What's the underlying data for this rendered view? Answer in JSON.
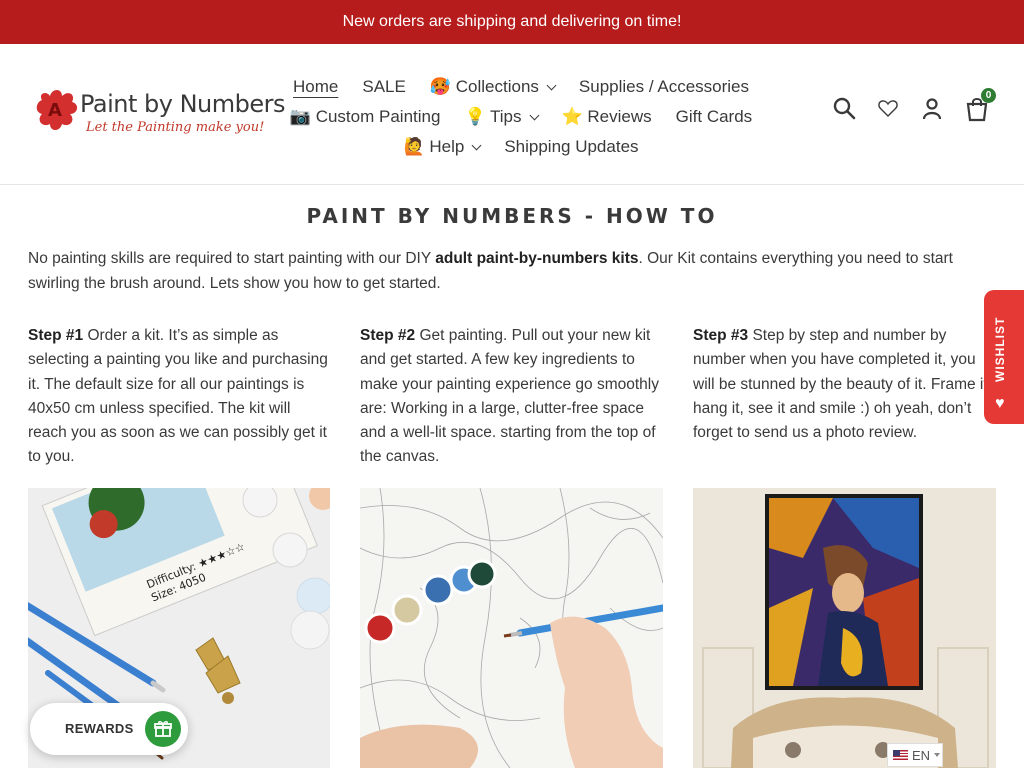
{
  "announcement": "New orders are shipping and delivering on time!",
  "logo": {
    "brand": "Paint by Numbers",
    "tagline": "Let the Painting make you!"
  },
  "nav": {
    "row1": [
      {
        "label": "Home",
        "active": true
      },
      {
        "label": "SALE"
      },
      {
        "label": "🥵 Collections",
        "dropdown": true
      },
      {
        "label": "Supplies / Accessories"
      }
    ],
    "row2": [
      {
        "label": "📷 Custom Painting"
      },
      {
        "label": "💡 Tips",
        "dropdown": true
      },
      {
        "label": "⭐ Reviews"
      },
      {
        "label": "Gift Cards"
      }
    ],
    "row3": [
      {
        "label": "🙋 Help",
        "dropdown": true
      },
      {
        "label": "Shipping Updates"
      }
    ]
  },
  "header_icons": {
    "cart_count": "0"
  },
  "page": {
    "title": "PAINT BY NUMBERS - HOW TO",
    "intro_pre": "No painting skills are required to start painting with our DIY ",
    "intro_bold": "adult paint-by-numbers kits",
    "intro_post": ". Our Kit contains everything you need to start swirling the brush around. Lets show you how to get started."
  },
  "steps": [
    {
      "label": "Step #1",
      "text": " Order a kit. It’s as simple as selecting a painting you like and purchasing it. The default size for all our paintings is 40x50 cm unless specified. The kit will reach you as soon as we can possibly get it to you."
    },
    {
      "label": "Step #2",
      "text": " Get painting. Pull out your new kit and get started. A few key ingredients to make your painting experience go smoothly are: Working in a large, clutter-free space and a well-lit space. starting from the top of the canvas."
    },
    {
      "label": "Step #3",
      "text": " Step by step and number by number when you have completed it, you will be stunned by the beauty of it. Frame it, hang it, see it and smile :) oh yeah, don’t forget to send us a photo review."
    }
  ],
  "step_images": {
    "kit_text_1": "Difficulty: ★★★☆☆",
    "kit_text_2": "Size: 4050"
  },
  "wishlist": {
    "label": "WISHLIST"
  },
  "rewards": {
    "label": "REWARDS"
  },
  "language": {
    "code": "EN"
  },
  "colors": {
    "announcement_bg": "#b71c1c",
    "wishlist_bg": "#e53935",
    "rewards_green": "#2e9b3c",
    "cart_badge": "#2e7d32"
  }
}
